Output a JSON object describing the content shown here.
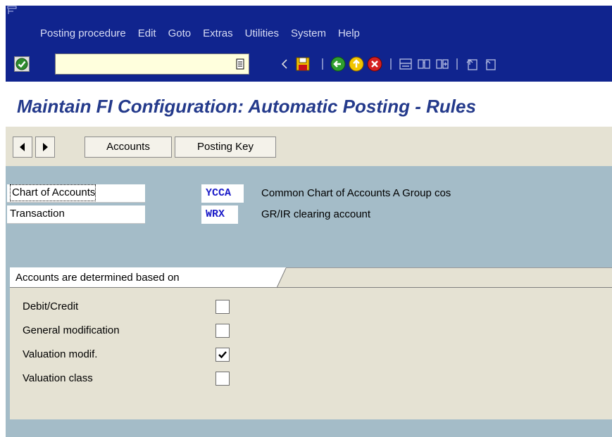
{
  "menu": {
    "items": [
      "Posting procedure",
      "Edit",
      "Goto",
      "Extras",
      "Utilities",
      "System",
      "Help"
    ]
  },
  "toolbar": {
    "command_field_value": "",
    "icons": [
      "enter-check-icon",
      "command-dropdown-icon",
      "prev-arrow-icon",
      "save-icon",
      "back-icon",
      "exit-icon",
      "cancel-icon",
      "print-icon",
      "find-icon",
      "find-next-icon",
      "first-page-icon",
      "prev-page-icon"
    ]
  },
  "title": "Maintain FI Configuration: Automatic Posting - Rules",
  "app_toolbar": {
    "accounts_label": "Accounts",
    "posting_key_label": "Posting Key"
  },
  "fields": {
    "chart_of_accounts": {
      "label": "Chart of Accounts",
      "value": "YCCA",
      "description": "Common Chart of Accounts A Group cos"
    },
    "transaction": {
      "label": "Transaction",
      "value": "WRX",
      "description": "GR/IR clearing account"
    }
  },
  "group": {
    "title": "Accounts are determined based on",
    "options": [
      {
        "label": "Debit/Credit",
        "checked": false
      },
      {
        "label": "General modification",
        "checked": false
      },
      {
        "label": "Valuation modif.",
        "checked": true
      },
      {
        "label": "Valuation class",
        "checked": false
      }
    ]
  },
  "colors": {
    "menubar": "#10248e",
    "title_text": "#243a8b",
    "content_bg": "#a4bcc8",
    "panel_bg": "#e5e2d3",
    "value_text": "#1a1ac8"
  }
}
